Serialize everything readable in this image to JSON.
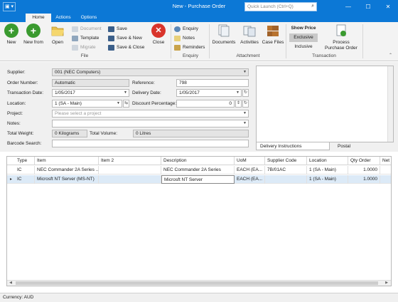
{
  "titlebar": {
    "title": "New - Purchase Order",
    "quick_launch_placeholder": "Quick Launch (Ctrl+Q)",
    "app_button": "▣ ▾",
    "minimize": "—",
    "maximize": "☐",
    "close": "✕"
  },
  "tabs": [
    "Home",
    "Actions",
    "Options"
  ],
  "ribbon": {
    "new": "New",
    "new_from": "New from",
    "open": "Open",
    "document": "Document",
    "template": "Template",
    "migrate": "Migrate",
    "save": "Save",
    "save_new": "Save & New",
    "save_close": "Save & Close",
    "close": "Close",
    "enquiry": "Enquiry",
    "notes": "Notes",
    "reminders": "Reminders",
    "documents": "Documents",
    "activities": "Activities",
    "case_files": "Case Files",
    "show_price": "Show Price",
    "exclusive": "Exclusive",
    "inclusive": "Inclusive",
    "process_po_1": "Process",
    "process_po_2": "Purchase Order",
    "groups": {
      "file": "File",
      "enquiry": "Enquiry",
      "attachment": "Attachment",
      "transaction": "Transaction"
    }
  },
  "form": {
    "supplier_label": "Supplier:",
    "supplier_value": "001  (NEC Computers)",
    "order_number_label": "Order Number:",
    "order_number_value": "Automatic",
    "reference_label": "Reference:",
    "reference_value": "798",
    "transaction_date_label": "Transaction Date:",
    "transaction_date_value": "1/05/2017",
    "delivery_date_label": "Delivery Date:",
    "delivery_date_value": "1/05/2017",
    "location_label": "Location:",
    "location_value": "1  (SA - Main)",
    "discount_label": "Discount Percentage:",
    "discount_value": "0",
    "project_label": "Project:",
    "project_placeholder": "Please select a project",
    "notes_label": "Notes:",
    "notes_value": "",
    "total_weight_label": "Total Weight:",
    "total_weight_value": "0 Kilograms",
    "total_volume_label": "Total Volume:",
    "total_volume_value": "0 Litres",
    "barcode_label": "Barcode Search:",
    "barcode_value": ""
  },
  "panel_tabs": [
    "Delivery Instructions",
    "Postal"
  ],
  "grid": {
    "columns": [
      "Type",
      "Item",
      "Item 2",
      "Description",
      "UoM",
      "Supplier Code",
      "Location",
      "Qty Order",
      "Net D"
    ],
    "rows": [
      [
        "IC",
        "NEC Commander 2A Series ...",
        "",
        "NEC Commander 2A Series",
        "EACH  (EA...",
        "7B/01AC",
        "1  (SA - Main)",
        "1.0000",
        ""
      ],
      [
        "IC",
        "Microsft NT Server  (MS-NT)",
        "",
        "Microsft NT Server",
        "EACH  (EA...",
        "",
        "1  (SA - Main)",
        "1.0000",
        ""
      ]
    ],
    "current_row_marker": "▸"
  },
  "status": {
    "currency": "Currency: AUD"
  },
  "colors": {
    "accent": "#0c78d6",
    "ribbon_bg": "#f3f3f3",
    "selected_row": "#dceaf7"
  }
}
